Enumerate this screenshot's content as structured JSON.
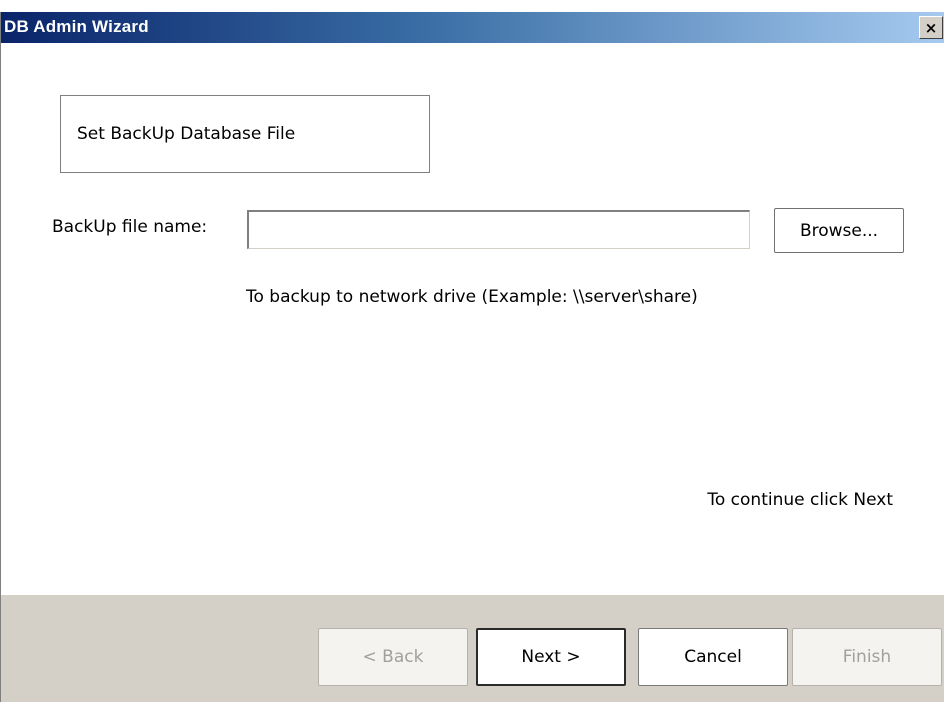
{
  "window": {
    "title": "DB Admin Wizard",
    "close_glyph": "×"
  },
  "step": {
    "title": "Set BackUp Database File"
  },
  "backup_field": {
    "label": "BackUp file name:",
    "value": "",
    "placeholder": ""
  },
  "browse_label": "Browse...",
  "hint": "To backup to network drive (Example: \\\\server\\share)",
  "continue_text": "To continue click Next",
  "buttons": {
    "back": "< Back",
    "next": "Next >",
    "cancel": "Cancel",
    "finish": "Finish"
  },
  "colors": {
    "titlebar_start": "#0a246a",
    "titlebar_end": "#a6caf0",
    "footer_bg": "#d4d0c8",
    "disabled_text": "#a0a0a0"
  }
}
